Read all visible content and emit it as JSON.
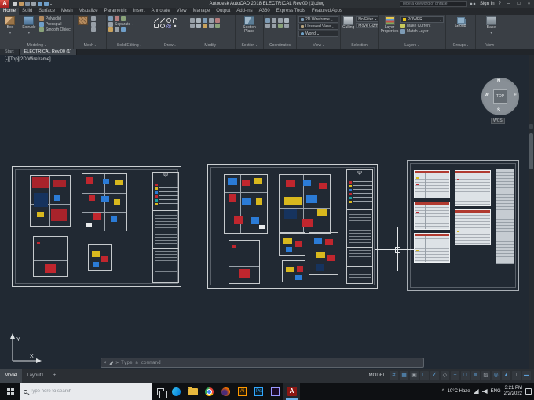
{
  "titlebar": {
    "logo": "A",
    "title": "Autodesk AutoCAD 2018   ELECTRICAL Rev.00 (1).dwg",
    "search_placeholder": "Type a keyword or phrase",
    "signin": "Sign In",
    "help": "?",
    "minimize": "─",
    "restore": "□",
    "close": "×"
  },
  "ribbon": {
    "tabs": [
      "Home",
      "Solid",
      "Surface",
      "Mesh",
      "Visualize",
      "Parametric",
      "Insert",
      "Annotate",
      "View",
      "Manage",
      "Output",
      "Add-ins",
      "A360",
      "Express Tools",
      "Featured Apps"
    ],
    "active_tab": "Home",
    "dropdown_arrow": "▾",
    "panels": [
      {
        "name": "Modeling",
        "tools": [
          "Box",
          "Extrude",
          "Polysolid",
          "Presspull",
          "Smooth Object"
        ]
      },
      {
        "name": "Mesh",
        "tools": []
      },
      {
        "name": "Solid Editing",
        "tools": [
          "Separate"
        ]
      },
      {
        "name": "Draw",
        "tools": []
      },
      {
        "name": "Modify",
        "tools": []
      },
      {
        "name": "Section",
        "tools": [
          "Section Plane"
        ]
      },
      {
        "name": "Coordinates",
        "tools": []
      },
      {
        "name": "View",
        "tools": [
          "2D Wireframe",
          "Unsaved View",
          "World"
        ]
      },
      {
        "name": "Selection",
        "tools": [
          "Culling",
          "No Filter",
          "Move Gizmo"
        ]
      },
      {
        "name": "Layers",
        "tools": [
          "Layer Properties",
          "POWER",
          "Make Current",
          "Match Layer"
        ]
      },
      {
        "name": "Groups",
        "tools": [
          "Group"
        ]
      },
      {
        "name": "View",
        "tools": [
          "Base"
        ]
      }
    ]
  },
  "file_tabs": [
    "Start",
    "ELECTRICAL Rev.00 (1)"
  ],
  "viewport": {
    "label": "[-][Top][2D Wireframe]",
    "viewcube": {
      "n": "N",
      "s": "S",
      "e": "E",
      "w": "W",
      "face": "TOP",
      "wcs": "WCS"
    },
    "ucs": {
      "x": "X",
      "y": "Y"
    }
  },
  "drawing": {
    "antenna_symbol": "Ψ"
  },
  "command_line": {
    "close": "×",
    "prompt": ">",
    "placeholder": "Type a command"
  },
  "statusbar": {
    "model_label": "MODEL",
    "layout_tabs": [
      "Model",
      "Layout1"
    ],
    "add_tab": "+",
    "icons": [
      "#",
      "▦",
      "▣",
      "∟",
      "∠",
      "◇",
      "+",
      "□",
      "≡",
      "▨",
      "◎",
      "▲",
      "⊥",
      "▬"
    ]
  },
  "taskbar": {
    "search_placeholder": "Type here to search",
    "ai_label": "Ai",
    "ps_label": "Ps",
    "autocad_label": "A",
    "tray": {
      "chevron": "^",
      "weather": "10°C Haze",
      "lang": "ENG",
      "time": "3:21 PM",
      "date": "2/2/2022"
    }
  }
}
